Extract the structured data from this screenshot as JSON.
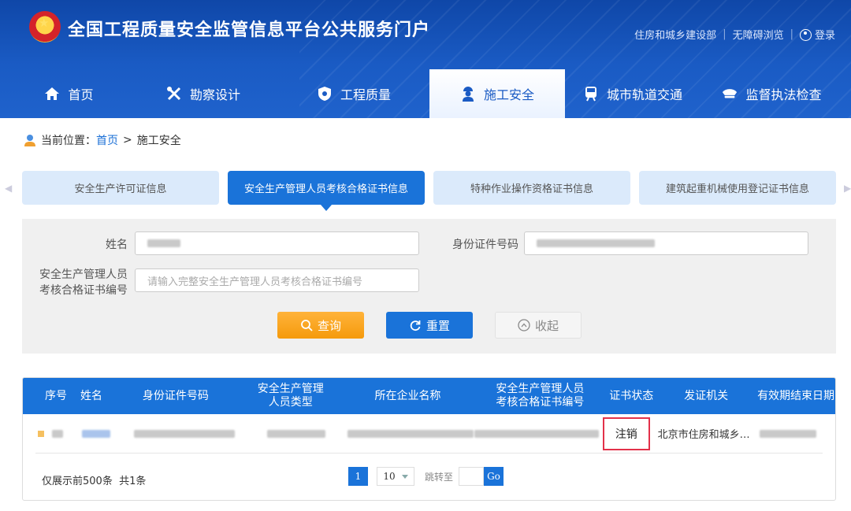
{
  "header": {
    "title": "全国工程质量安全监管信息平台公共服务门户",
    "link_ministry": "住房和城乡建设部",
    "link_accessible": "无障碍浏览",
    "link_login": "登录"
  },
  "nav": [
    {
      "label": "首页",
      "icon": "home-icon"
    },
    {
      "label": "勘察设计",
      "icon": "tools-icon"
    },
    {
      "label": "工程质量",
      "icon": "shield-icon"
    },
    {
      "label": "施工安全",
      "icon": "worker-icon",
      "active": true
    },
    {
      "label": "城市轨道交通",
      "icon": "train-icon"
    },
    {
      "label": "监督执法检查",
      "icon": "police-cap-icon"
    }
  ],
  "breadcrumb": {
    "prefix": "当前位置：",
    "home": "首页",
    "sep": ">",
    "current": "施工安全"
  },
  "tabs": [
    {
      "label": "安全生产许可证信息"
    },
    {
      "label": "安全生产管理人员考核合格证书信息",
      "active": true
    },
    {
      "label": "特种作业操作资格证书信息"
    },
    {
      "label": "建筑起重机械使用登记证书信息"
    }
  ],
  "search": {
    "name_label": "姓名",
    "id_label": "身份证件号码",
    "cert_label_1": "安全生产管理人员",
    "cert_label_2": "考核合格证书编号",
    "cert_placeholder": "请输入完整安全生产管理人员考核合格证书编号",
    "query_btn": "查询",
    "reset_btn": "重置",
    "collapse_btn": "收起"
  },
  "table": {
    "headers": {
      "seq": "序号",
      "name": "姓名",
      "id_number": "身份证件号码",
      "type_1": "安全生产管理",
      "type_2": "人员类型",
      "company": "所在企业名称",
      "cert_1": "安全生产管理人员",
      "cert_2": "考核合格证书编号",
      "status": "证书状态",
      "issuer": "发证机关",
      "end_date": "有效期结束日期"
    },
    "rows": [
      {
        "status": "注销",
        "issuer": "北京市住房和城乡…"
      }
    ]
  },
  "pager": {
    "summary": "仅展示前500条  共1条",
    "current_page": "1",
    "page_size": "10",
    "jump_label": "跳转至",
    "go_label": "Go"
  },
  "colors": {
    "primary": "#1a73d9",
    "header": "#1a5bc4",
    "query": "#f59a0c",
    "status_border": "#e3314a"
  }
}
